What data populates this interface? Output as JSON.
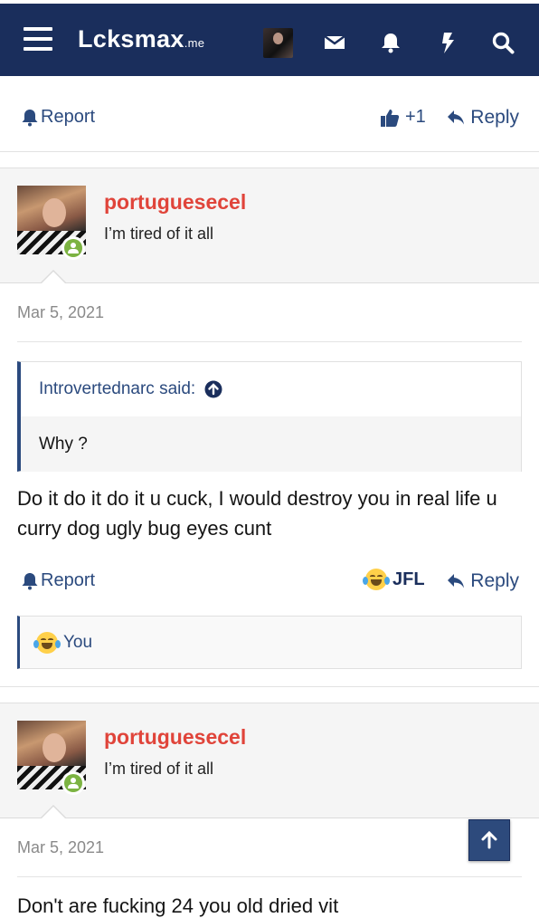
{
  "header": {
    "logo_text": "Lcksmax",
    "logo_tld": ".me",
    "colors": {
      "nav_bg": "#1a2e5c",
      "accent": "#2b4a7e",
      "username": "#e0443a",
      "online": "#7cb342"
    },
    "icons": [
      "menu-icon",
      "user-avatar",
      "envelope-icon",
      "bell-icon",
      "bolt-icon",
      "search-icon"
    ]
  },
  "post_prev_actions": {
    "report_label": "Report",
    "like_count": "+1",
    "reply_label": "Reply"
  },
  "post1": {
    "username": "portuguesecel",
    "user_title": "I’m tired of it all",
    "date": "Mar 5, 2021",
    "quote_author": "Introvertednarc said:",
    "quote_text": "Why ?",
    "body": "Do it do it do it u cuck, I would destroy you in real life u curry dog ugly bug eyes cunt",
    "report_label": "Report",
    "reaction_label": "JFL",
    "reply_label": "Reply",
    "reactions_summary": "You"
  },
  "post2": {
    "username": "portuguesecel",
    "user_title": "I’m tired of it all",
    "date": "Mar 5, 2021",
    "body_partial": "Don't are fucking 24 you old dried vit"
  }
}
